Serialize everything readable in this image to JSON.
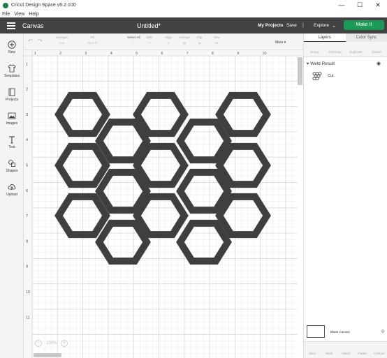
{
  "window": {
    "title": "Cricut Design Space  v6.2.100",
    "controls": [
      "—",
      "☐",
      "✕"
    ]
  },
  "menu": [
    "File",
    "View",
    "Help"
  ],
  "header": {
    "section": "Canvas",
    "doc_title": "Untitled*",
    "my_projects": "My Projects",
    "save": "Save",
    "separator": "|",
    "machine": "Explore",
    "machine_chevron": "⌄",
    "make_it": "Make It"
  },
  "toolbar": {
    "items": [
      {
        "label": "Linetype",
        "control": "Cut"
      },
      {
        "label": "Fill",
        "control": "No Fill"
      },
      {
        "label": "Select All",
        "control": ""
      },
      {
        "label": "Edit",
        "control": ""
      },
      {
        "label": "Align",
        "control": ""
      },
      {
        "label": "Arrange",
        "control": ""
      },
      {
        "label": "Flip",
        "control": ""
      },
      {
        "label": "Size",
        "control": "W"
      }
    ],
    "more": "More ▾"
  },
  "leftbar": [
    {
      "label": "New",
      "icon": "plus-icon"
    },
    {
      "label": "Templates",
      "icon": "shirt-icon"
    },
    {
      "label": "Projects",
      "icon": "book-icon"
    },
    {
      "label": "Images",
      "icon": "image-icon"
    },
    {
      "label": "Text",
      "icon": "text-icon"
    },
    {
      "label": "Shapes",
      "icon": "shapes-icon"
    },
    {
      "label": "Upload",
      "icon": "cloud-upload-icon"
    }
  ],
  "rightpanel": {
    "tabs": [
      "Layers",
      "Color Sync"
    ],
    "tools": [
      "Group",
      "UnGroup",
      "Duplicate",
      "Delete"
    ],
    "layer_group": "Weld Result",
    "layer_item": "Cut",
    "blank_canvas": "Blank Canvas",
    "bottom_tools": [
      "Slice",
      "Weld",
      "Attach",
      "Flatten",
      "Contour"
    ]
  },
  "canvas": {
    "ruler_top": [
      "1",
      "2",
      "3",
      "4",
      "5",
      "6",
      "7",
      "8",
      "9",
      "10"
    ],
    "ruler_left": [
      "1",
      "2",
      "3",
      "4",
      "5",
      "6",
      "7",
      "8",
      "9",
      "10",
      "11"
    ],
    "zoom": "100%",
    "shape_color": "#3f3f3f",
    "grid_color": "#d8d8d8"
  }
}
